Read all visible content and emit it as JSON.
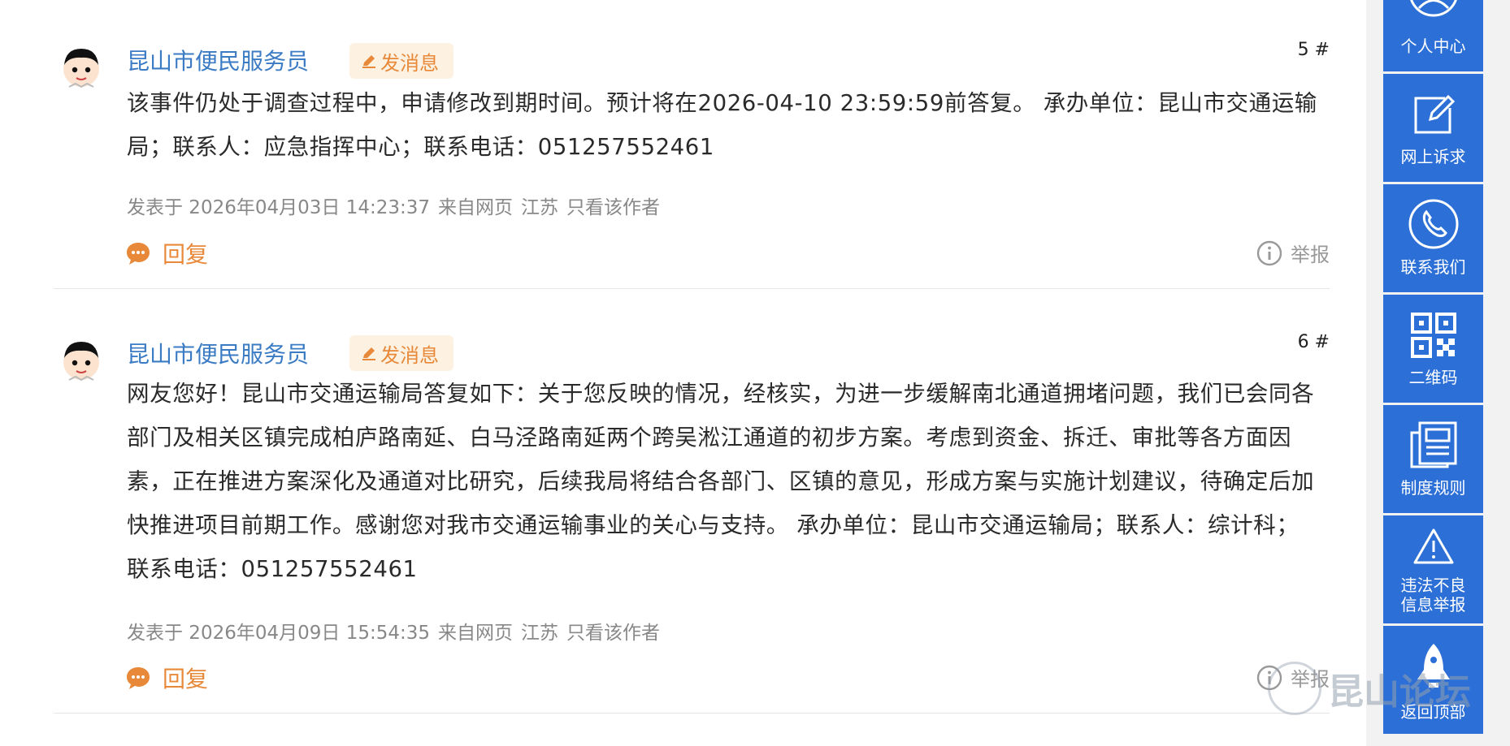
{
  "posts": [
    {
      "author": "昆山市便民服务员",
      "message_button": "发消息",
      "floor": "5 #",
      "content": "该事件仍处于调查过程中，申请修改到期时间。预计将在2026-04-10 23:59:59前答复。 承办单位：昆山市交通运输局；联系人：应急指挥中心；联系电话：051257552461",
      "posted_at": "发表于 2026年04月03日 14:23:37",
      "source": "来自网页",
      "region": "江苏",
      "only_author": "只看该作者",
      "reply": "回复",
      "report": "举报"
    },
    {
      "author": "昆山市便民服务员",
      "message_button": "发消息",
      "floor": "6 #",
      "content": "网友您好！昆山市交通运输局答复如下：关于您反映的情况，经核实，为进一步缓解南北通道拥堵问题，我们已会同各部门及相关区镇完成柏庐路南延、白马泾路南延两个跨吴淞江通道的初步方案。考虑到资金、拆迁、审批等各方面因素，正在推进方案深化及通道对比研究，后续我局将结合各部门、区镇的意见，形成方案与实施计划建议，待确定后加快推进项目前期工作。感谢您对我市交通运输事业的关心与支持。 承办单位：昆山市交通运输局；联系人：综计科；联系电话：051257552461",
      "posted_at": "发表于 2026年04月09日 15:54:35",
      "source": "来自网页",
      "region": "江苏",
      "only_author": "只看该作者",
      "reply": "回复",
      "report": "举报"
    }
  ],
  "sidebar": {
    "items": [
      {
        "label": "个人中心",
        "icon": "user-icon"
      },
      {
        "label": "网上诉求",
        "icon": "edit-icon"
      },
      {
        "label": "联系我们",
        "icon": "phone-icon"
      },
      {
        "label": "二维码",
        "icon": "qrcode-icon"
      },
      {
        "label": "制度规则",
        "icon": "document-icon"
      },
      {
        "label": "违法不良\n信息举报",
        "icon": "warning-icon"
      },
      {
        "label": "返回顶部",
        "icon": "rocket-icon"
      }
    ]
  },
  "watermark": "昆山论坛",
  "colors": {
    "accent_blue": "#2c6fd6",
    "author_blue": "#3b7bc4",
    "orange": "#e8893a"
  }
}
